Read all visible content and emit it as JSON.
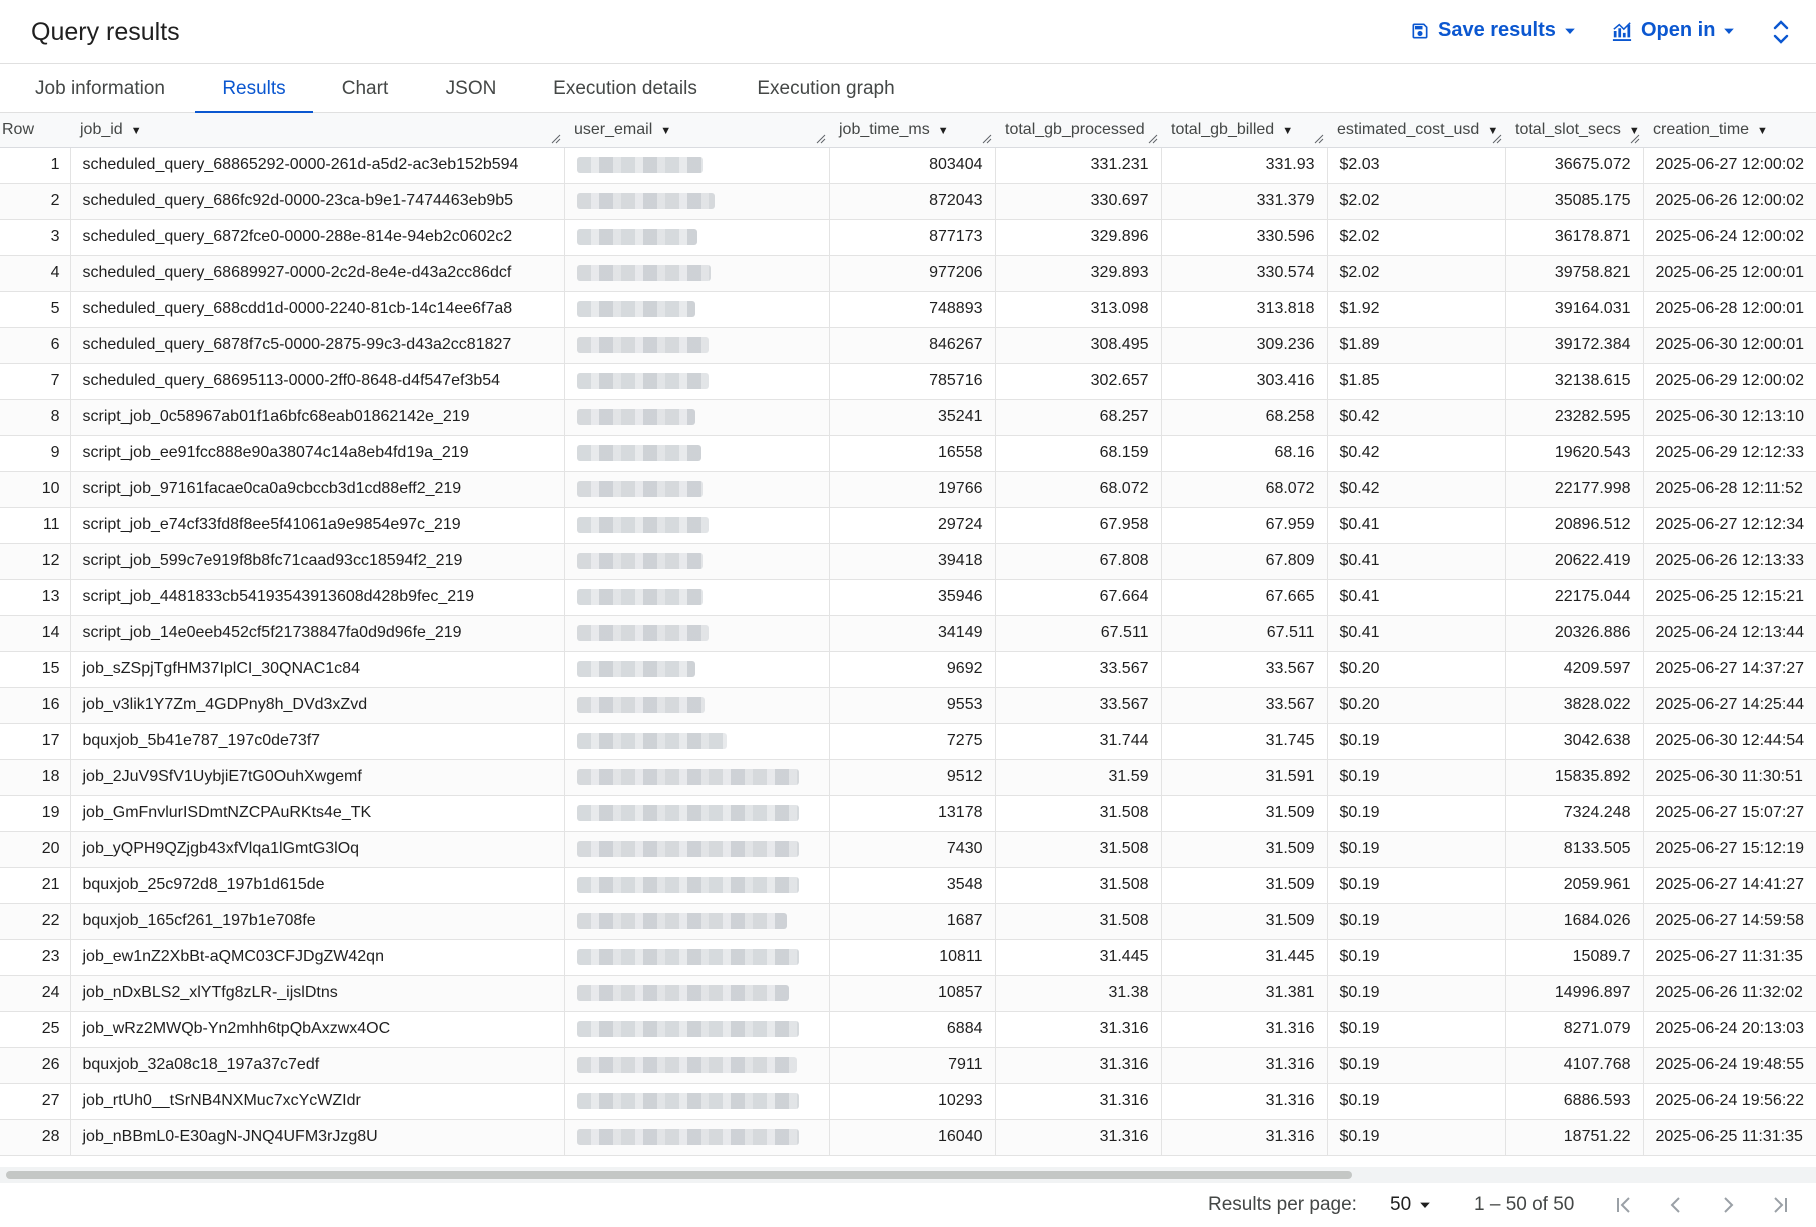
{
  "header": {
    "title": "Query results",
    "save_label": "Save results",
    "open_label": "Open in",
    "accent_color": "#0b57d0"
  },
  "tabs": [
    {
      "label": "Job information"
    },
    {
      "label": "Results"
    },
    {
      "label": "Chart"
    },
    {
      "label": "JSON"
    },
    {
      "label": "Execution details"
    },
    {
      "label": "Execution graph"
    }
  ],
  "active_tab": "Results",
  "table": {
    "columns": [
      "Row",
      "job_id",
      "user_email",
      "job_time_ms",
      "total_gb_processed",
      "total_gb_billed",
      "estimated_cost_usd",
      "total_slot_secs",
      "creation_time"
    ],
    "rows": [
      [
        "1",
        "scheduled_query_68865292-0000-261d-a5d2-ac3eb152b594",
        "803404",
        "331.231",
        "331.93",
        "$2.03",
        "36675.072",
        "2025-06-27 12:00:02"
      ],
      [
        "2",
        "scheduled_query_686fc92d-0000-23ca-b9e1-7474463eb9b5",
        "872043",
        "330.697",
        "331.379",
        "$2.02",
        "35085.175",
        "2025-06-26 12:00:02"
      ],
      [
        "3",
        "scheduled_query_6872fce0-0000-288e-814e-94eb2c0602c2",
        "877173",
        "329.896",
        "330.596",
        "$2.02",
        "36178.871",
        "2025-06-24 12:00:02"
      ],
      [
        "4",
        "scheduled_query_68689927-0000-2c2d-8e4e-d43a2cc86dcf",
        "977206",
        "329.893",
        "330.574",
        "$2.02",
        "39758.821",
        "2025-06-25 12:00:01"
      ],
      [
        "5",
        "scheduled_query_688cdd1d-0000-2240-81cb-14c14ee6f7a8",
        "748893",
        "313.098",
        "313.818",
        "$1.92",
        "39164.031",
        "2025-06-28 12:00:01"
      ],
      [
        "6",
        "scheduled_query_6878f7c5-0000-2875-99c3-d43a2cc81827",
        "846267",
        "308.495",
        "309.236",
        "$1.89",
        "39172.384",
        "2025-06-30 12:00:01"
      ],
      [
        "7",
        "scheduled_query_68695113-0000-2ff0-8648-d4f547ef3b54",
        "785716",
        "302.657",
        "303.416",
        "$1.85",
        "32138.615",
        "2025-06-29 12:00:02"
      ],
      [
        "8",
        "script_job_0c58967ab01f1a6bfc68eab01862142e_219",
        "35241",
        "68.257",
        "68.258",
        "$0.42",
        "23282.595",
        "2025-06-30 12:13:10"
      ],
      [
        "9",
        "script_job_ee91fcc888e90a38074c14a8eb4fd19a_219",
        "16558",
        "68.159",
        "68.16",
        "$0.42",
        "19620.543",
        "2025-06-29 12:12:33"
      ],
      [
        "10",
        "script_job_97161facae0ca0a9cbccb3d1cd88eff2_219",
        "19766",
        "68.072",
        "68.072",
        "$0.42",
        "22177.998",
        "2025-06-28 12:11:52"
      ],
      [
        "11",
        "script_job_e74cf33fd8f8ee5f41061a9e9854e97c_219",
        "29724",
        "67.958",
        "67.959",
        "$0.41",
        "20896.512",
        "2025-06-27 12:12:34"
      ],
      [
        "12",
        "script_job_599c7e919f8b8fc71caad93cc18594f2_219",
        "39418",
        "67.808",
        "67.809",
        "$0.41",
        "20622.419",
        "2025-06-26 12:13:33"
      ],
      [
        "13",
        "script_job_4481833cb54193543913608d428b9fec_219",
        "35946",
        "67.664",
        "67.665",
        "$0.41",
        "22175.044",
        "2025-06-25 12:15:21"
      ],
      [
        "14",
        "script_job_14e0eeb452cf5f21738847fa0d9d96fe_219",
        "34149",
        "67.511",
        "67.511",
        "$0.41",
        "20326.886",
        "2025-06-24 12:13:44"
      ],
      [
        "15",
        "job_sZSpjTgfHM37IplCI_30QNAC1c84",
        "9692",
        "33.567",
        "33.567",
        "$0.20",
        "4209.597",
        "2025-06-27 14:37:27"
      ],
      [
        "16",
        "job_v3lik1Y7Zm_4GDPny8h_DVd3xZvd",
        "9553",
        "33.567",
        "33.567",
        "$0.20",
        "3828.022",
        "2025-06-27 14:25:44"
      ],
      [
        "17",
        "bquxjob_5b41e787_197c0de73f7",
        "7275",
        "31.744",
        "31.745",
        "$0.19",
        "3042.638",
        "2025-06-30 12:44:54"
      ],
      [
        "18",
        "job_2JuV9SfV1UybjiE7tG0OuhXwgemf",
        "9512",
        "31.59",
        "31.591",
        "$0.19",
        "15835.892",
        "2025-06-30 11:30:51"
      ],
      [
        "19",
        "job_GmFnvlurISDmtNZCPAuRKts4e_TK",
        "13178",
        "31.508",
        "31.509",
        "$0.19",
        "7324.248",
        "2025-06-27 15:07:27"
      ],
      [
        "20",
        "job_yQPH9QZjgb43xfVlqa1lGmtG3lOq",
        "7430",
        "31.508",
        "31.509",
        "$0.19",
        "8133.505",
        "2025-06-27 15:12:19"
      ],
      [
        "21",
        "bquxjob_25c972d8_197b1d615de",
        "3548",
        "31.508",
        "31.509",
        "$0.19",
        "2059.961",
        "2025-06-27 14:41:27"
      ],
      [
        "22",
        "bquxjob_165cf261_197b1e708fe",
        "1687",
        "31.508",
        "31.509",
        "$0.19",
        "1684.026",
        "2025-06-27 14:59:58"
      ],
      [
        "23",
        "job_ew1nZ2XbBt-aQMC03CFJDgZW42qn",
        "10811",
        "31.445",
        "31.445",
        "$0.19",
        "15089.7",
        "2025-06-27 11:31:35"
      ],
      [
        "24",
        "job_nDxBLS2_xlYTfg8zLR-_ijslDtns",
        "10857",
        "31.38",
        "31.381",
        "$0.19",
        "14996.897",
        "2025-06-26 11:32:02"
      ],
      [
        "25",
        "job_wRz2MWQb-Yn2mhh6tpQbAxzwx4OC",
        "6884",
        "31.316",
        "31.316",
        "$0.19",
        "8271.079",
        "2025-06-24 20:13:03"
      ],
      [
        "26",
        "bquxjob_32a08c18_197a37c7edf",
        "7911",
        "31.316",
        "31.316",
        "$0.19",
        "4107.768",
        "2025-06-24 19:48:55"
      ],
      [
        "27",
        "job_rtUh0__tSrNB4NXMuc7xcYcWZIdr",
        "10293",
        "31.316",
        "31.316",
        "$0.19",
        "6886.593",
        "2025-06-24 19:56:22"
      ],
      [
        "28",
        "job_nBBmL0-E30agN-JNQ4UFM3rJzg8U",
        "16040",
        "31.316",
        "31.316",
        "$0.19",
        "18751.22",
        "2025-06-25 11:31:35"
      ]
    ]
  },
  "footer": {
    "results_per_page_label": "Results per page:",
    "results_per_page_value": "50",
    "range_text": "1 – 50 of 50"
  }
}
